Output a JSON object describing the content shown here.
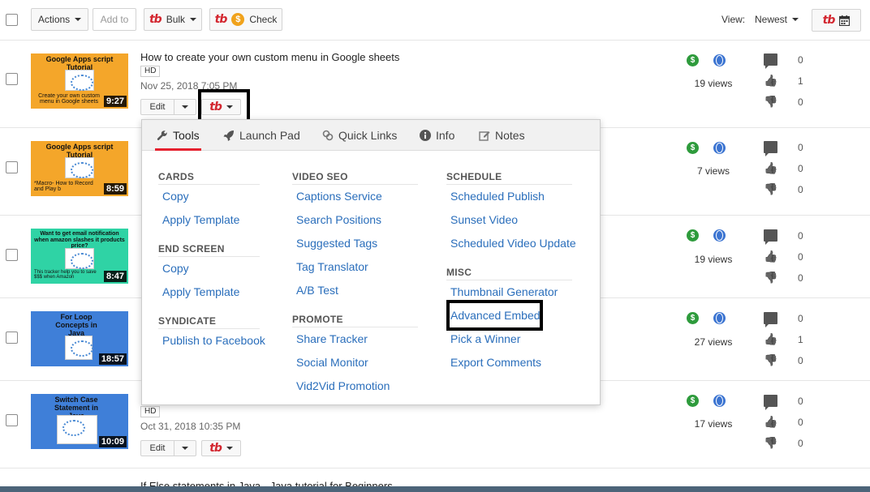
{
  "toolbar": {
    "actions_label": "Actions",
    "add_to_label": "Add to",
    "bulk_label": "Bulk",
    "check_label": "Check",
    "view_label": "View:",
    "sort_label": "Newest",
    "tb_logo": "tb",
    "coin_glyph": "$"
  },
  "videos": [
    {
      "thumb_title": "Google Apps script Tutorial",
      "thumb_sub": "Create your own custom menu in Google sheets",
      "duration": "9:27",
      "title": "How to create your own custom menu in Google sheets",
      "hd": "HD",
      "date": "Nov 25, 2018 7:05 PM",
      "views": "19 views",
      "comments": "0",
      "likes": "1",
      "dislikes": "0"
    },
    {
      "thumb_title": "Google Apps script Tutorial",
      "thumb_sub": "*Macro- How to Record and Play b",
      "duration": "8:59",
      "views": "7 views",
      "comments": "0",
      "likes": "0",
      "dislikes": "0"
    },
    {
      "thumb_title": "Want to get email notification when amazon slashes it products price?",
      "thumb_sub": "This tracker help you to save $$$ when Amazon",
      "duration": "8:47",
      "views": "19 views",
      "comments": "0",
      "likes": "0",
      "dislikes": "0"
    },
    {
      "thumb_title": "For Loop Concepts in Java",
      "duration": "18:57",
      "views": "27 views",
      "comments": "0",
      "likes": "1",
      "dislikes": "0"
    },
    {
      "thumb_title": "Switch Case Statement in Java",
      "duration": "10:09",
      "hd": "HD",
      "date": "Oct 31, 2018 10:35 PM",
      "views": "17 views",
      "comments": "0",
      "likes": "0",
      "dislikes": "0"
    }
  ],
  "row_controls": {
    "edit_label": "Edit"
  },
  "next_title": "If Else statements in Java - Java tutorial for Beginners",
  "menu": {
    "tabs": [
      "Tools",
      "Launch Pad",
      "Quick Links",
      "Info",
      "Notes"
    ],
    "cards": {
      "header": "CARDS",
      "items": [
        "Copy",
        "Apply Template"
      ]
    },
    "end_screen": {
      "header": "END SCREEN",
      "items": [
        "Copy",
        "Apply Template"
      ]
    },
    "syndicate": {
      "header": "SYNDICATE",
      "items": [
        "Publish to Facebook"
      ]
    },
    "video_seo": {
      "header": "VIDEO SEO",
      "items": [
        "Captions Service",
        "Search Positions",
        "Suggested Tags",
        "Tag Translator",
        "A/B Test"
      ]
    },
    "promote": {
      "header": "PROMOTE",
      "items": [
        "Share Tracker",
        "Social Monitor",
        "Vid2Vid Promotion"
      ]
    },
    "schedule": {
      "header": "SCHEDULE",
      "items": [
        "Scheduled Publish",
        "Sunset Video",
        "Scheduled Video Update"
      ]
    },
    "misc": {
      "header": "MISC",
      "items": [
        "Thumbnail Generator",
        "Advanced Embed",
        "Pick a Winner",
        "Export Comments"
      ]
    }
  },
  "colors": {
    "accent_red": "#e5202e",
    "link_blue": "#2a6ebb",
    "money_green": "#2e9b3c",
    "globe_blue": "#3b74d1"
  }
}
